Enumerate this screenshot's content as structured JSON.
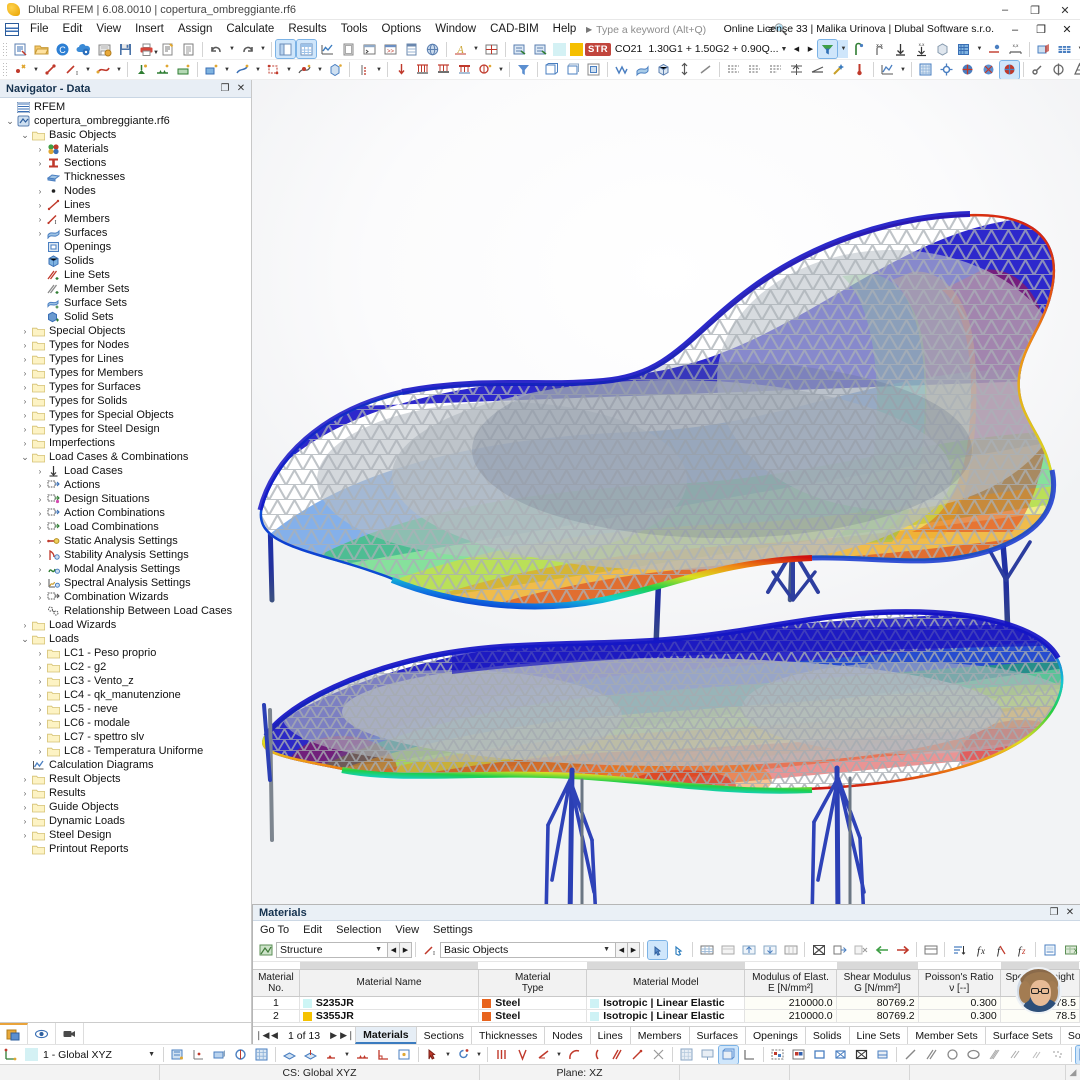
{
  "titlebar": {
    "title": "Dlubal RFEM | 6.08.0010 | copertura_ombreggiante.rf6",
    "minimize": "–",
    "maximize": "❐",
    "close": "✕"
  },
  "menubar": {
    "items": [
      "File",
      "Edit",
      "View",
      "Insert",
      "Assign",
      "Calculate",
      "Results",
      "Tools",
      "Options",
      "Window",
      "CAD-BIM",
      "Help"
    ],
    "search_placeholder": "Type a keyword (Alt+Q)",
    "license": "Online License 33 | Malika Urinova | Dlubal Software s.r.o.",
    "win_minimize": "–",
    "win_restore": "❐",
    "win_close": "✕"
  },
  "results_toolbar": {
    "color_swatch_1": "#d4f1f4",
    "color_swatch_2": "#f5bf00",
    "category_badge": "STR",
    "combination_id": "CO21",
    "combination_formula": "1.30G1 + 1.50G2 + 0.90Q...",
    "dropdown_glyph": "⌄",
    "prev_glyph": "◀",
    "next_glyph": "▶",
    "overflow_glyph": "»"
  },
  "navigator": {
    "title": "Navigator - Data",
    "float_glyph": "❐",
    "close_glyph": "✕",
    "tree": [
      {
        "depth": 0,
        "twisty": "none",
        "icon": "rfem-logo-icon",
        "label": "RFEM"
      },
      {
        "depth": 0,
        "twisty": "open",
        "icon": "model-file-icon",
        "label": "copertura_ombreggiante.rf6"
      },
      {
        "depth": 1,
        "twisty": "open",
        "icon": "folder-icon",
        "label": "Basic Objects"
      },
      {
        "depth": 2,
        "twisty": "closed",
        "icon": "materials-icon",
        "label": "Materials"
      },
      {
        "depth": 2,
        "twisty": "closed",
        "icon": "sections-icon",
        "label": "Sections"
      },
      {
        "depth": 2,
        "twisty": "none",
        "icon": "thicknesses-icon",
        "label": "Thicknesses"
      },
      {
        "depth": 2,
        "twisty": "closed",
        "icon": "nodes-icon",
        "label": "Nodes"
      },
      {
        "depth": 2,
        "twisty": "closed",
        "icon": "lines-icon",
        "label": "Lines"
      },
      {
        "depth": 2,
        "twisty": "closed",
        "icon": "members-icon",
        "label": "Members"
      },
      {
        "depth": 2,
        "twisty": "closed",
        "icon": "surfaces-icon",
        "label": "Surfaces"
      },
      {
        "depth": 2,
        "twisty": "none",
        "icon": "openings-icon",
        "label": "Openings"
      },
      {
        "depth": 2,
        "twisty": "none",
        "icon": "solids-icon",
        "label": "Solids"
      },
      {
        "depth": 2,
        "twisty": "none",
        "icon": "line-sets-icon",
        "label": "Line Sets"
      },
      {
        "depth": 2,
        "twisty": "none",
        "icon": "member-sets-icon",
        "label": "Member Sets"
      },
      {
        "depth": 2,
        "twisty": "none",
        "icon": "surface-sets-icon",
        "label": "Surface Sets"
      },
      {
        "depth": 2,
        "twisty": "none",
        "icon": "solid-sets-icon",
        "label": "Solid Sets"
      },
      {
        "depth": 1,
        "twisty": "closed",
        "icon": "folder-icon",
        "label": "Special Objects"
      },
      {
        "depth": 1,
        "twisty": "closed",
        "icon": "folder-icon",
        "label": "Types for Nodes"
      },
      {
        "depth": 1,
        "twisty": "closed",
        "icon": "folder-icon",
        "label": "Types for Lines"
      },
      {
        "depth": 1,
        "twisty": "closed",
        "icon": "folder-icon",
        "label": "Types for Members"
      },
      {
        "depth": 1,
        "twisty": "closed",
        "icon": "folder-icon",
        "label": "Types for Surfaces"
      },
      {
        "depth": 1,
        "twisty": "closed",
        "icon": "folder-icon",
        "label": "Types for Solids"
      },
      {
        "depth": 1,
        "twisty": "closed",
        "icon": "folder-icon",
        "label": "Types for Special Objects"
      },
      {
        "depth": 1,
        "twisty": "closed",
        "icon": "folder-icon",
        "label": "Types for Steel Design"
      },
      {
        "depth": 1,
        "twisty": "closed",
        "icon": "folder-icon",
        "label": "Imperfections"
      },
      {
        "depth": 1,
        "twisty": "open",
        "icon": "folder-icon",
        "label": "Load Cases & Combinations"
      },
      {
        "depth": 2,
        "twisty": "closed",
        "icon": "load-cases-icon",
        "label": "Load Cases"
      },
      {
        "depth": 2,
        "twisty": "closed",
        "icon": "actions-icon",
        "label": "Actions"
      },
      {
        "depth": 2,
        "twisty": "closed",
        "icon": "design-situations-icon",
        "label": "Design Situations"
      },
      {
        "depth": 2,
        "twisty": "closed",
        "icon": "action-combinations-icon",
        "label": "Action Combinations"
      },
      {
        "depth": 2,
        "twisty": "closed",
        "icon": "load-combinations-icon",
        "label": "Load Combinations"
      },
      {
        "depth": 2,
        "twisty": "closed",
        "icon": "static-analysis-icon",
        "label": "Static Analysis Settings"
      },
      {
        "depth": 2,
        "twisty": "closed",
        "icon": "stability-analysis-icon",
        "label": "Stability Analysis Settings"
      },
      {
        "depth": 2,
        "twisty": "closed",
        "icon": "modal-analysis-icon",
        "label": "Modal Analysis Settings"
      },
      {
        "depth": 2,
        "twisty": "closed",
        "icon": "spectral-analysis-icon",
        "label": "Spectral Analysis Settings"
      },
      {
        "depth": 2,
        "twisty": "closed",
        "icon": "combination-wizards-icon",
        "label": "Combination Wizards"
      },
      {
        "depth": 2,
        "twisty": "none",
        "icon": "relationship-icon",
        "label": "Relationship Between Load Cases"
      },
      {
        "depth": 1,
        "twisty": "closed",
        "icon": "folder-icon",
        "label": "Load Wizards"
      },
      {
        "depth": 1,
        "twisty": "open",
        "icon": "folder-icon",
        "label": "Loads"
      },
      {
        "depth": 2,
        "twisty": "closed",
        "icon": "folder-icon",
        "label": "LC1 - Peso proprio"
      },
      {
        "depth": 2,
        "twisty": "closed",
        "icon": "folder-icon",
        "label": "LC2 - g2"
      },
      {
        "depth": 2,
        "twisty": "closed",
        "icon": "folder-icon",
        "label": "LC3 - Vento_z"
      },
      {
        "depth": 2,
        "twisty": "closed",
        "icon": "folder-icon",
        "label": "LC4 - qk_manutenzione"
      },
      {
        "depth": 2,
        "twisty": "closed",
        "icon": "folder-icon",
        "label": "LC5 - neve"
      },
      {
        "depth": 2,
        "twisty": "closed",
        "icon": "folder-icon",
        "label": "LC6 - modale"
      },
      {
        "depth": 2,
        "twisty": "closed",
        "icon": "folder-icon",
        "label": "LC7 - spettro slv"
      },
      {
        "depth": 2,
        "twisty": "closed",
        "icon": "folder-icon",
        "label": "LC8 - Temperatura Uniforme"
      },
      {
        "depth": 1,
        "twisty": "none",
        "icon": "calculation-diagrams-icon",
        "label": "Calculation Diagrams"
      },
      {
        "depth": 1,
        "twisty": "closed",
        "icon": "folder-icon",
        "label": "Result Objects"
      },
      {
        "depth": 1,
        "twisty": "closed",
        "icon": "folder-icon",
        "label": "Results"
      },
      {
        "depth": 1,
        "twisty": "closed",
        "icon": "folder-icon",
        "label": "Guide Objects"
      },
      {
        "depth": 1,
        "twisty": "closed",
        "icon": "folder-icon",
        "label": "Dynamic Loads"
      },
      {
        "depth": 1,
        "twisty": "closed",
        "icon": "folder-icon",
        "label": "Steel Design"
      },
      {
        "depth": 1,
        "twisty": "none",
        "icon": "folder-icon",
        "label": "Printout Reports"
      }
    ],
    "footer_buttons": [
      "navigator-toggle-icon",
      "visibility-eye-icon",
      "camera-icon"
    ]
  },
  "materials_panel": {
    "title": "Materials",
    "float_glyph": "❐",
    "close_glyph": "✕",
    "menu": [
      "Go To",
      "Edit",
      "Selection",
      "View",
      "Settings"
    ],
    "combo_structure": "Structure",
    "combo_objects": "Basic Objects",
    "dropdown_glyph": "⌄",
    "prev_glyph": "◀",
    "next_glyph": "▶",
    "overflow_glyph": "»",
    "columns": [
      {
        "l1": "Material",
        "l2": "No.",
        "w": 50,
        "align": "ctr"
      },
      {
        "l1": "",
        "l2": "Material Name",
        "w": 193,
        "align": "left"
      },
      {
        "l1": "Material",
        "l2": "Type",
        "w": 116,
        "align": "left"
      },
      {
        "l1": "",
        "l2": "Material Model",
        "w": 170,
        "align": "left"
      },
      {
        "l1": "Modulus of Elast.",
        "l2": "E [N/mm²]",
        "w": 98,
        "align": "num"
      },
      {
        "l1": "Shear Modulus",
        "l2": "G [N/mm²]",
        "w": 88,
        "align": "num"
      },
      {
        "l1": "Poisson's Ratio",
        "l2": "ν [--]",
        "w": 88,
        "align": "num"
      },
      {
        "l1": "Specific Weight",
        "l2": "γ [kN/m³]",
        "w": 85,
        "align": "num"
      }
    ],
    "rows": [
      {
        "no": "1",
        "name": "S235JR",
        "name_color": "#ccf5f5",
        "type": "Steel",
        "type_color": "#e8641e",
        "model": "Isotropic | Linear Elastic",
        "model_color": "#cef2f5",
        "e": "210000.0",
        "g": "80769.2",
        "nu": "0.300",
        "gamma": "78.5"
      },
      {
        "no": "2",
        "name": "S355JR",
        "name_color": "#f5c200",
        "type": "Steel",
        "type_color": "#e8641e",
        "model": "Isotropic | Linear Elastic",
        "model_color": "#cef2f5",
        "e": "210000.0",
        "g": "80769.2",
        "nu": "0.300",
        "gamma": "78.5"
      }
    ],
    "pager": {
      "first": "❘◀",
      "prev": "◀",
      "text": "1 of 13",
      "next": "▶",
      "last": "▶❘"
    },
    "tabs": [
      "Materials",
      "Sections",
      "Thicknesses",
      "Nodes",
      "Lines",
      "Members",
      "Surfaces",
      "Openings",
      "Solids",
      "Line Sets",
      "Member Sets",
      "Surface Sets",
      "Solid Sets"
    ],
    "selected_tab": "Materials"
  },
  "bottom_bar": {
    "cs_combo": "1 - Global XYZ",
    "cs_swatch": "#d4f1f4",
    "dropdown_glyph": "⌄"
  },
  "statusbar": {
    "cs": "CS: Global XYZ",
    "plane": "Plane: XZ",
    "resize_glyph": "◢"
  },
  "viewport": {
    "model_name": "copertura_ombreggiante",
    "render_mode": "deformation-contour",
    "background": "#ffffff"
  }
}
